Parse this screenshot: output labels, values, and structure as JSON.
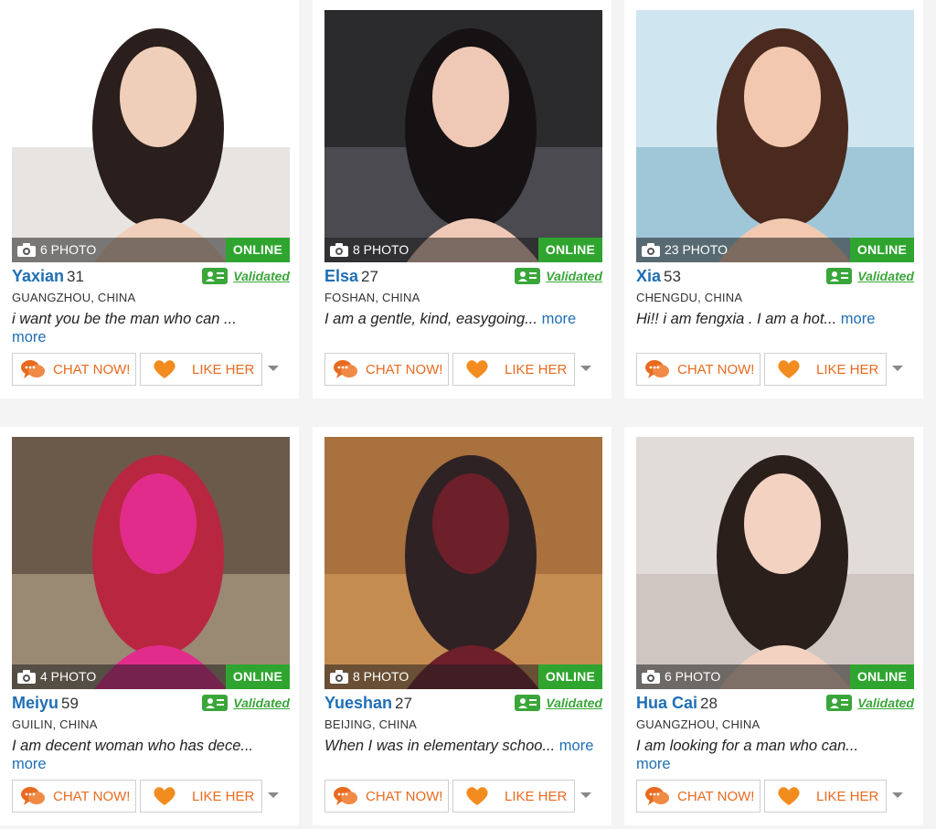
{
  "labels": {
    "online": "ONLINE",
    "validated": "Validated",
    "chat": "CHAT NOW!",
    "like": "LIKE HER",
    "more": "more"
  },
  "colors": {
    "accent": "#e86a1f",
    "name": "#1f6fb5",
    "online": "#2fa52f",
    "validated": "#3aa63a"
  },
  "profiles": [
    {
      "name": "Yaxian",
      "age": "31",
      "photos": "6 PHOTO",
      "city": "GUANGZHOU, CHINA",
      "bio": "i want you be the man who can ...",
      "photo_colors": [
        "#ffffff",
        "#e8e4e2",
        "#2a1f1c",
        "#efcfb9"
      ]
    },
    {
      "name": "Elsa",
      "age": "27",
      "photos": "8 PHOTO",
      "city": "FOSHAN, CHINA",
      "bio": "I am a gentle, kind, easygoing...",
      "photo_colors": [
        "#2b2b2e",
        "#4a4a50",
        "#161214",
        "#f0c9b6"
      ]
    },
    {
      "name": "Xia",
      "age": "53",
      "photos": "23 PHOTO",
      "city": "CHENGDU, CHINA",
      "bio": "Hi!! i am fengxia . I am a hot...",
      "photo_colors": [
        "#cfe5ef",
        "#9fc7d8",
        "#4a2a1e",
        "#f2c9b0"
      ]
    },
    {
      "name": "Meiyu",
      "age": "59",
      "photos": "4 PHOTO",
      "city": "GUILIN, CHINA",
      "bio": "I am decent woman who has dece...",
      "photo_colors": [
        "#6b5a4a",
        "#9a8a74",
        "#b8273f",
        "#e12c8b"
      ]
    },
    {
      "name": "Yueshan",
      "age": "27",
      "photos": "8 PHOTO",
      "city": "BEIJING, CHINA",
      "bio": "When I was in elementary schoo...",
      "photo_colors": [
        "#a8713e",
        "#c58c51",
        "#2e2224",
        "#6d1f2a"
      ]
    },
    {
      "name": "Hua Cai",
      "age": "28",
      "photos": "6 PHOTO",
      "city": "GUANGZHOU, CHINA",
      "bio": "I am looking for a man who can...",
      "photo_colors": [
        "#e2dcd8",
        "#cfc6c1",
        "#2a1f1b",
        "#f3d2c2"
      ]
    }
  ]
}
